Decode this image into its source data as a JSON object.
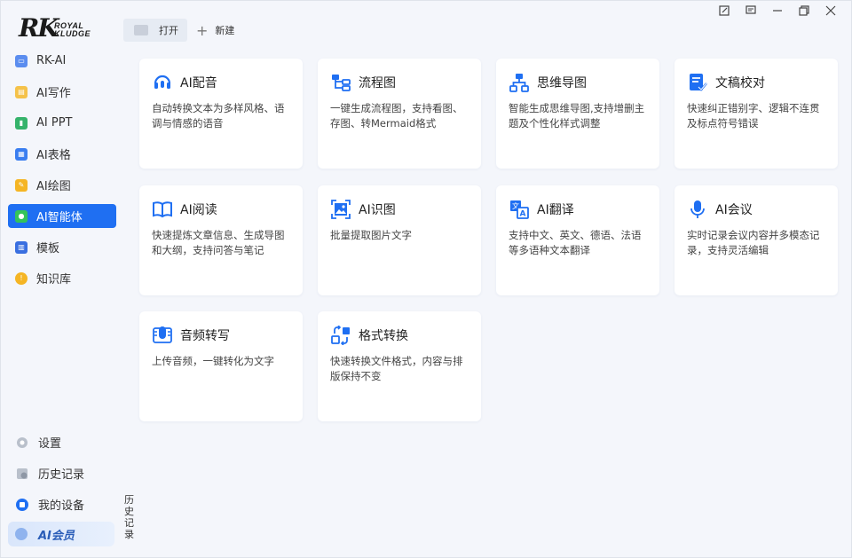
{
  "brand": {
    "logo_main": "RK",
    "logo_sub1": "ROYAL",
    "logo_sub2": "KLUDGE"
  },
  "toolbar": {
    "open_label": "打开",
    "new_label": "新建"
  },
  "window_controls": [
    "edit-icon",
    "feedback-icon",
    "minimize-icon",
    "restore-icon",
    "close-icon"
  ],
  "sidebar": {
    "items": [
      {
        "label": "RK-AI",
        "icon": "rk-ai-icon",
        "color": "#5b8def"
      },
      {
        "label": "AI写作",
        "icon": "writing-icon",
        "color": "#f5c24a"
      },
      {
        "label": "AI PPT",
        "icon": "ppt-icon",
        "color": "#35b36b"
      },
      {
        "label": "AI表格",
        "icon": "table-icon",
        "color": "#3a7ef0"
      },
      {
        "label": "AI绘图",
        "icon": "paint-icon",
        "color": "#f5b524"
      },
      {
        "label": "AI智能体",
        "icon": "agent-icon",
        "color": "#34c35a",
        "active": true
      },
      {
        "label": "模板",
        "icon": "template-icon",
        "color": "#3a6fe0"
      },
      {
        "label": "知识库",
        "icon": "knowledge-icon",
        "color": "#f5b524"
      }
    ],
    "bottom": [
      {
        "label": "设置",
        "icon": "gear-icon"
      },
      {
        "label": "历史记录",
        "icon": "history-icon"
      },
      {
        "label": "我的设备",
        "icon": "device-icon"
      }
    ],
    "vip_label": "AI会员",
    "history_vertical": "历史记录"
  },
  "cards": [
    {
      "title": "AI配音",
      "desc": "自动转换文本为多样风格、语调与情感的语音",
      "icon": "voice-dubbing-icon"
    },
    {
      "title": "流程图",
      "desc": "一键生成流程图，支持看图、存图、转Mermaid格式",
      "icon": "flowchart-icon"
    },
    {
      "title": "思维导图",
      "desc": "智能生成思维导图,支持增删主题及个性化样式调整",
      "icon": "mindmap-icon"
    },
    {
      "title": "文稿校对",
      "desc": "快速纠正错别字、逻辑不连贯及标点符号错误",
      "icon": "proofread-icon"
    },
    {
      "title": "AI阅读",
      "desc": "快速提炼文章信息、生成导图和大纲，支持问答与笔记",
      "icon": "book-icon"
    },
    {
      "title": "AI识图",
      "desc": "批量提取图片文字",
      "icon": "image-recognition-icon"
    },
    {
      "title": "AI翻译",
      "desc": "支持中文、英文、德语、法语等多语种文本翻译",
      "icon": "translate-icon"
    },
    {
      "title": "AI会议",
      "desc": "实时记录会议内容并多模态记录，支持灵活编辑",
      "icon": "microphone-icon"
    },
    {
      "title": "音频转写",
      "desc": "上传音频，一键转化为文字",
      "icon": "audio-transcribe-icon"
    },
    {
      "title": "格式转换",
      "desc": "快速转换文件格式，内容与排版保持不变",
      "icon": "format-convert-icon"
    }
  ],
  "colors": {
    "accent": "#1f6ff2",
    "card_icon": "#1f6ff2"
  }
}
